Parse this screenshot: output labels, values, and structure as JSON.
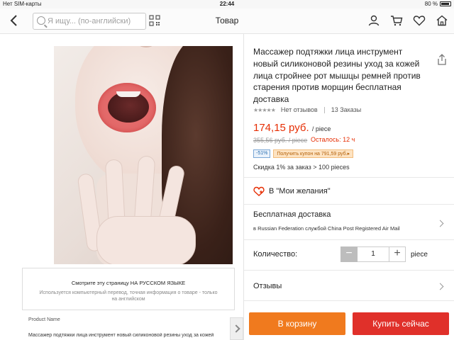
{
  "status_bar": {
    "carrier": "Нет SIM-карты",
    "time": "22:44",
    "battery": "80 %"
  },
  "nav": {
    "search_placeholder": "Я ищу... (по-английски)",
    "title": "Товар",
    "icons": [
      "back-icon",
      "search-icon",
      "qr-code-icon",
      "user-icon",
      "cart-icon",
      "heart-icon",
      "home-icon"
    ]
  },
  "gallery": {
    "dot_count": 6,
    "active_dot": 0
  },
  "translate_notice": {
    "title": "Смотрите эту страницу НА РУССКОМ ЯЗЫКЕ",
    "body": "Используется компьютерный перевод, точная информация о товаре - только на английском"
  },
  "product_name": {
    "label": "Product Name",
    "text": "Массажер подтяжки лица инструмент новый силиконовой резины уход за кожей"
  },
  "product": {
    "title": "Массажер подтяжки лица инструмент новый силиконовой резины уход за кожей лица стройнее рот мышцы ремней против старения против морщин бесплатная доставка",
    "stars": "★★★★★",
    "reviews_text": "Нет отзывов",
    "orders_text": "13 Заказы",
    "price": "174,15 руб.",
    "price_unit": "/ piece",
    "old_price": "355,56 руб. / piece",
    "remaining": "Осталось: 12 ч",
    "discount_badge": "-51%",
    "coupon_badge": "Получить купон на 791,59 руб.▸",
    "bulk_discount": "Скидка 1% за заказ > 100 pieces"
  },
  "wishlist": {
    "label": "В \"Мои желания\""
  },
  "shipping": {
    "title": "Бесплатная доставка",
    "detail": "в Russian Federation службой China Post Registered Air Mail"
  },
  "quantity": {
    "label": "Количество:",
    "minus": "−",
    "value": "1",
    "plus": "+",
    "unit": "piece"
  },
  "reviews_section": {
    "label": "Отзывы"
  },
  "actions": {
    "add_to_cart": "В корзину",
    "buy_now": "Купить сейчас"
  },
  "colors": {
    "price_red": "#e62e04",
    "cart_orange": "#f07a1e",
    "buy_red": "#e0302a"
  }
}
